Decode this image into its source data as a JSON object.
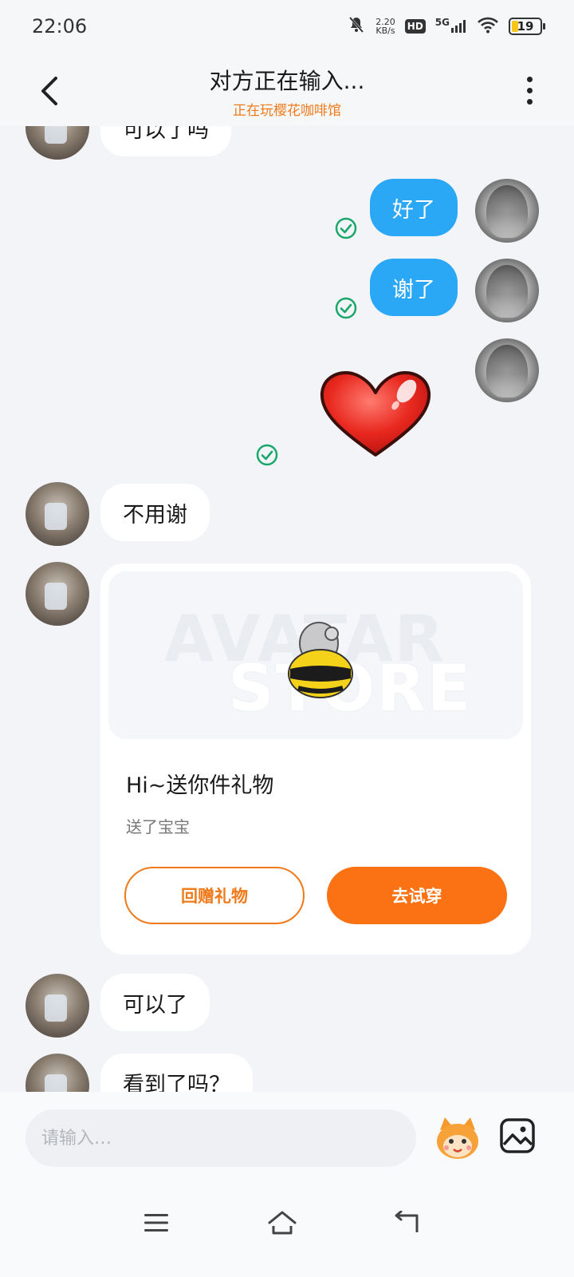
{
  "status_bar": {
    "time": "22:06",
    "net_speed_value": "2.20",
    "net_speed_unit": "KB/s",
    "hd": "HD",
    "network": "5G",
    "battery": "19"
  },
  "header": {
    "title": "对方正在输入...",
    "subtitle": "正在玩樱花咖啡馆",
    "accent_color": "#f07a1a"
  },
  "messages": [
    {
      "side": "left",
      "text": "可以了吗",
      "partially_visible": true
    },
    {
      "side": "right",
      "text": "好了",
      "read": true
    },
    {
      "side": "right",
      "text": "谢了",
      "read": true
    },
    {
      "side": "right",
      "type": "sticker",
      "sticker": "red-heart",
      "read": true
    },
    {
      "side": "left",
      "text": "不用谢"
    },
    {
      "side": "left",
      "type": "gift_card",
      "gift": {
        "banner_text_1": "AVATAR",
        "banner_text_2": "STORE",
        "item_icon": "bee-costume-icon",
        "title": "Hi~送你件礼物",
        "subtitle": "送了宝宝",
        "return_gift_label": "回赠礼物",
        "try_on_label": "去试穿"
      }
    },
    {
      "side": "left",
      "text": "可以了"
    },
    {
      "side": "left",
      "text": "看到了吗？",
      "partially_visible": true
    }
  ],
  "input": {
    "placeholder": "请输入…"
  },
  "colors": {
    "bubble_right": "#2aa7f5",
    "bubble_left": "#ffffff",
    "read_check": "#1aa86a",
    "primary_button": "#fb7214"
  },
  "nav": [
    "menu-icon",
    "home-icon",
    "back-icon"
  ]
}
